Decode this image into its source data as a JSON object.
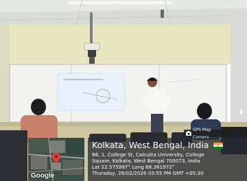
{
  "overlay": {
    "location_title": "Kolkata, West Bengal, India",
    "address_line1": "86, 1, College St, Calcutta University, College",
    "address_line2": "Square, Kolkata, West Bengal 700073, India",
    "coordinates": "Lat 22.575997° Long 88.361972°",
    "datetime": "Thursday, 26/02/2026 03:55 PM GMT +05:30"
  },
  "badge": {
    "label": "GPS Map Camera"
  },
  "map": {
    "logo_text": "Google"
  },
  "colors": {
    "overlay_bg": "#2c3038",
    "pin": "#e53935",
    "flag_saffron": "#FF9933",
    "flag_green": "#138808"
  },
  "icons": [
    "camera-icon",
    "map-pin-icon",
    "india-flag-icon"
  ]
}
